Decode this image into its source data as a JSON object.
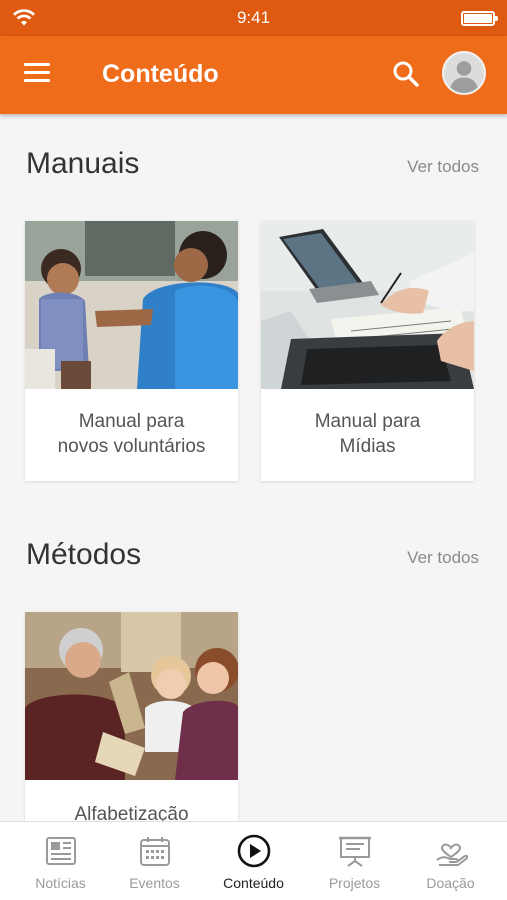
{
  "status_bar": {
    "time": "9:41"
  },
  "app_bar": {
    "title": "Conteúdo"
  },
  "sections": {
    "manuais": {
      "title": "Manuais",
      "see_all": "Ver todos",
      "cards": [
        {
          "line1": "Manual para",
          "line2": "novos voluntários"
        },
        {
          "line1": "Manual para",
          "line2": "Mídias"
        }
      ]
    },
    "metodos": {
      "title": "Métodos",
      "see_all": "Ver todos",
      "cards": [
        {
          "line1": "Alfabetização",
          "line2": ""
        }
      ]
    }
  },
  "tab_bar": {
    "tabs": [
      {
        "label": "Notícias",
        "icon": "newspaper-icon",
        "active": false
      },
      {
        "label": "Eventos",
        "icon": "calendar-icon",
        "active": false
      },
      {
        "label": "Conteúdo",
        "icon": "play-circle-icon",
        "active": true
      },
      {
        "label": "Projetos",
        "icon": "presentation-board-icon",
        "active": false
      },
      {
        "label": "Doação",
        "icon": "heart-hand-icon",
        "active": false
      }
    ]
  },
  "colors": {
    "status_bar": "#de5a10",
    "app_bar": "#ef6c1b",
    "background": "#f5f5f5"
  }
}
